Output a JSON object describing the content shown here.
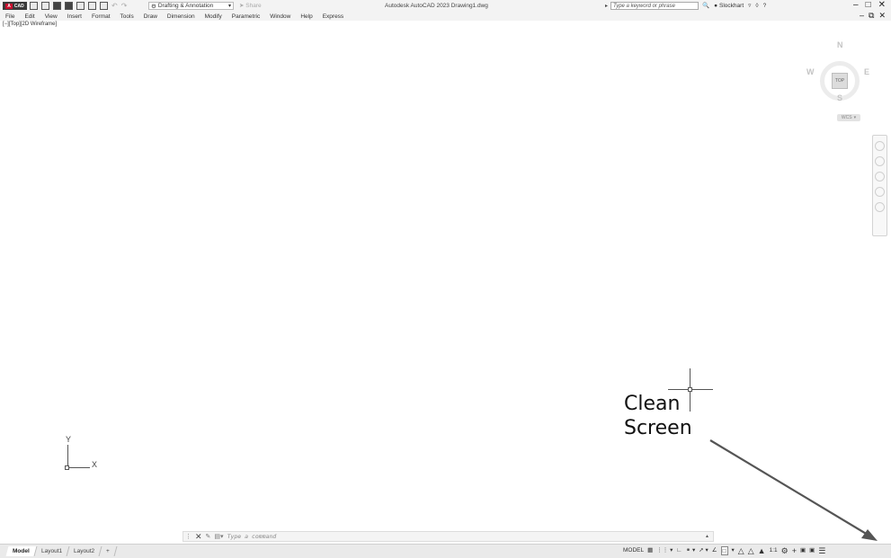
{
  "titlebar": {
    "app_button": "CAD",
    "app_letter": "A",
    "workspace": "Drafting & Annotation",
    "share": "Share",
    "title": "Autodesk AutoCAD 2023   Drawing1.dwg",
    "search_placeholder": "Type a keyword or phrase",
    "user": "Slockhart",
    "help": "?"
  },
  "menu": [
    "File",
    "Edit",
    "View",
    "Insert",
    "Format",
    "Tools",
    "Draw",
    "Dimension",
    "Modify",
    "Parametric",
    "Window",
    "Help",
    "Express"
  ],
  "viewport_label": "[−][Top][2D Wireframe]",
  "viewcube": {
    "top": "TOP",
    "north": "N",
    "south": "S",
    "east": "E",
    "west": "W",
    "wcs": "WCS"
  },
  "ucs": {
    "x": "X",
    "y": "Y"
  },
  "annotation": {
    "line1": "Clean",
    "line2": "Screen"
  },
  "command": {
    "placeholder": "Type a command"
  },
  "tabs": [
    "Model",
    "Layout1",
    "Layout2",
    "+"
  ],
  "status": {
    "model": "MODEL",
    "scale": "1:1"
  }
}
